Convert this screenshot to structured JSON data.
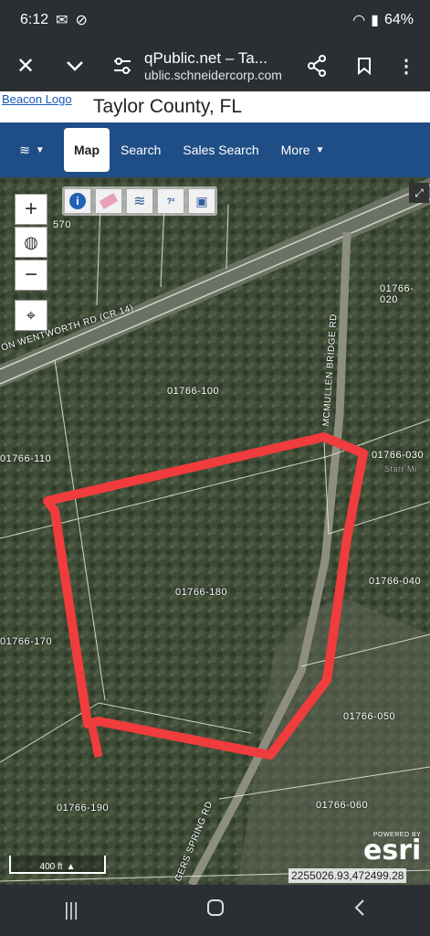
{
  "status_bar": {
    "time": "6:12",
    "battery": "64%"
  },
  "browser": {
    "title": "qPublic.net – Ta...",
    "url": "ublic.schneidercorp.com"
  },
  "banner": {
    "logo_alt": "Beacon Logo",
    "county": "Taylor County, FL"
  },
  "nav": {
    "items": [
      "Map",
      "Search",
      "Sales Search",
      "More"
    ],
    "active": "Map"
  },
  "map": {
    "parcels": [
      "570",
      "01766-020",
      "01766-100",
      "01766-110",
      "01766-030",
      "01766-180",
      "01766-040",
      "01766-170",
      "01766-050",
      "01766-190",
      "01766-060"
    ],
    "roads": [
      "ON WENTWORTH RD (CR 14)",
      "MCMULLEN BRIDGE RD",
      "GERS SPRING RD"
    ],
    "faint_label": "Starr Mi",
    "scale_label": "400 ft",
    "coordinates": "2255026.93,472499.28",
    "powered_by": "POWERED BY",
    "esri": "esri",
    "boundary_color": "#f03c3c"
  }
}
